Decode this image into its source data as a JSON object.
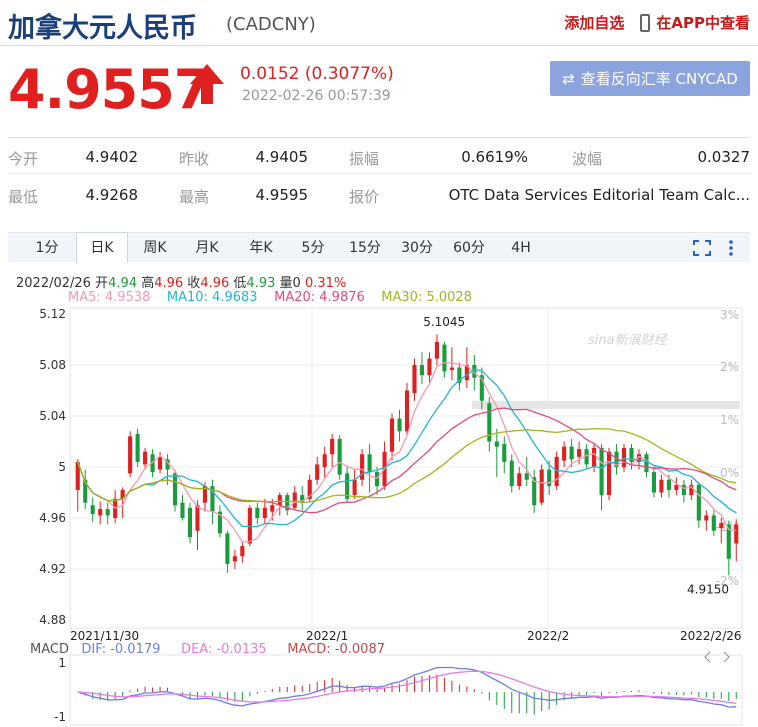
{
  "header": {
    "title": "加拿大元人民币",
    "symbol": "(CADCNY)",
    "add_watchlist": "添加自选",
    "view_in_app": "在APP中查看"
  },
  "quote": {
    "price": "4.9557",
    "change": "0.0152 (0.3077%)",
    "timestamp": "2022-02-26 00:57:39",
    "reverse_button": "查看反向汇率 CNYCAD"
  },
  "stats": {
    "row1": [
      {
        "label": "今开",
        "value": "4.9402"
      },
      {
        "label": "昨收",
        "value": "4.9405"
      },
      {
        "label": "振幅",
        "value": "0.6619%"
      },
      {
        "label": "波幅",
        "value": "0.0327"
      }
    ],
    "row2": [
      {
        "label": "最低",
        "value": "4.9268"
      },
      {
        "label": "最高",
        "value": "4.9595"
      },
      {
        "label": "报价",
        "value": "OTC Data Services Editorial Team Calc..."
      }
    ]
  },
  "tabs": [
    "1分",
    "日K",
    "周K",
    "月K",
    "年K",
    "5分",
    "15分",
    "30分",
    "60分",
    "4H"
  ],
  "active_tab": "日K",
  "ohlc": {
    "date": "2022/02/26",
    "open_label": "开",
    "open": "4.94",
    "high_label": "高",
    "high": "4.96",
    "close_label": "收",
    "close": "4.96",
    "low_label": "低",
    "low": "4.93",
    "vol_label": "量",
    "vol": "0",
    "pct": "0.31%"
  },
  "ma": {
    "ma5": "MA5: 4.9538",
    "ma10": "MA10: 4.9683",
    "ma20": "MA20: 4.9876",
    "ma30": "MA30: 5.0028"
  },
  "macd": {
    "title": "MACD",
    "dif": "DIF: -0.0179",
    "dea": "DEA: -0.0135",
    "macd": "MACD: -0.0087"
  },
  "watermark": "sina新浪财经",
  "colors": {
    "up": "#e01f1f",
    "down": "#1a9c3c",
    "ma5": "#f29bb3",
    "ma10": "#22b5d6",
    "ma20": "#e24b7d",
    "ma30": "#9fb71e",
    "dif": "#6b7fe3",
    "dea": "#e57be6",
    "title": "#1a3f7a"
  },
  "chart_data": {
    "type": "candlestick",
    "y_ticks": [
      "5.12",
      "5.08",
      "5.04",
      "5",
      "4.96",
      "4.92",
      "4.88"
    ],
    "y_right_ticks": [
      "3%",
      "2%",
      "1%",
      "0%",
      "-1%",
      "-2%"
    ],
    "x_labels": [
      "2021/11/30",
      "2022/1",
      "2022/2",
      "2022/2/26"
    ],
    "ylim": [
      4.88,
      5.12
    ],
    "annotations": {
      "high": "5.1045",
      "low": "4.9150"
    },
    "candles": [
      [
        4.982,
        5.004,
        4.965,
        5.006
      ],
      [
        4.99,
        4.972,
        4.967,
        4.998
      ],
      [
        4.97,
        4.963,
        4.957,
        4.976
      ],
      [
        4.962,
        4.967,
        4.955,
        4.973
      ],
      [
        4.967,
        4.962,
        4.955,
        4.972
      ],
      [
        4.96,
        4.975,
        4.956,
        4.982
      ],
      [
        4.975,
        4.982,
        4.96,
        4.984
      ],
      [
        4.995,
        5.024,
        4.992,
        5.028
      ],
      [
        5.026,
        5.004,
        5.0,
        5.03
      ],
      [
        5.002,
        5.012,
        4.998,
        5.015
      ],
      [
        5.01,
        4.996,
        4.992,
        5.014
      ],
      [
        4.998,
        5.008,
        4.995,
        5.012
      ],
      [
        5.006,
        4.998,
        4.986,
        5.01
      ],
      [
        4.995,
        4.97,
        4.965,
        4.998
      ],
      [
        4.972,
        4.96,
        4.958,
        4.978
      ],
      [
        4.968,
        4.945,
        4.94,
        4.972
      ],
      [
        4.95,
        4.97,
        4.935,
        4.974
      ],
      [
        4.972,
        4.985,
        4.965,
        4.988
      ],
      [
        4.985,
        4.965,
        4.955,
        4.99
      ],
      [
        4.965,
        4.948,
        4.945,
        4.97
      ],
      [
        4.948,
        4.924,
        4.917,
        4.95
      ],
      [
        4.926,
        4.93,
        4.92,
        4.935
      ],
      [
        4.93,
        4.938,
        4.925,
        4.942
      ],
      [
        4.94,
        4.968,
        4.938,
        4.97
      ],
      [
        4.968,
        4.96,
        4.955,
        4.972
      ],
      [
        4.96,
        4.968,
        4.956,
        4.975
      ],
      [
        4.965,
        4.97,
        4.958,
        4.975
      ],
      [
        4.97,
        4.978,
        4.962,
        4.98
      ],
      [
        4.978,
        4.966,
        4.962,
        4.98
      ],
      [
        4.968,
        4.98,
        4.966,
        4.985
      ],
      [
        4.978,
        4.972,
        4.966,
        4.985
      ],
      [
        4.975,
        4.99,
        4.973,
        4.994
      ],
      [
        4.99,
        5.002,
        4.986,
        5.008
      ],
      [
        5.0,
        5.01,
        4.992,
        5.016
      ],
      [
        5.01,
        5.022,
        5.0,
        5.026
      ],
      [
        5.022,
        4.994,
        4.99,
        5.025
      ],
      [
        4.995,
        4.975,
        4.972,
        5.0
      ],
      [
        4.978,
        4.99,
        4.975,
        4.998
      ],
      [
        4.99,
        5.01,
        4.985,
        5.014
      ],
      [
        5.01,
        4.996,
        4.98,
        5.018
      ],
      [
        4.996,
        4.985,
        4.978,
        5.0
      ],
      [
        4.985,
        5.012,
        4.982,
        5.02
      ],
      [
        5.012,
        5.038,
        5.005,
        5.042
      ],
      [
        5.038,
        5.028,
        5.02,
        5.045
      ],
      [
        5.028,
        5.06,
        5.025,
        5.066
      ],
      [
        5.058,
        5.08,
        5.052,
        5.085
      ],
      [
        5.08,
        5.072,
        5.065,
        5.09
      ],
      [
        5.072,
        5.085,
        5.066,
        5.09
      ],
      [
        5.085,
        5.098,
        5.08,
        5.104
      ],
      [
        5.096,
        5.075,
        5.07,
        5.098
      ],
      [
        5.076,
        5.078,
        5.068,
        5.094
      ],
      [
        5.078,
        5.066,
        5.06,
        5.082
      ],
      [
        5.068,
        5.08,
        5.062,
        5.094
      ],
      [
        5.08,
        5.07,
        5.06,
        5.088
      ],
      [
        5.072,
        5.052,
        5.045,
        5.078
      ],
      [
        5.05,
        5.02,
        5.012,
        5.055
      ],
      [
        5.02,
        5.016,
        4.992,
        5.03
      ],
      [
        5.018,
        5.004,
        4.995,
        5.024
      ],
      [
        5.005,
        4.985,
        4.98,
        5.01
      ],
      [
        4.985,
        4.995,
        4.982,
        5.0
      ],
      [
        4.995,
        4.99,
        4.985,
        5.008
      ],
      [
        4.992,
        4.97,
        4.964,
        4.998
      ],
      [
        4.972,
        4.998,
        4.97,
        5.002
      ],
      [
        4.998,
        4.985,
        4.978,
        5.005
      ],
      [
        4.985,
        5.008,
        4.982,
        5.012
      ],
      [
        5.005,
        5.016,
        5.0,
        5.02
      ],
      [
        5.016,
        5.006,
        5.0,
        5.022
      ],
      [
        5.008,
        5.014,
        5.002,
        5.02
      ],
      [
        5.014,
        5.002,
        4.998,
        5.018
      ],
      [
        5.0,
        5.015,
        4.996,
        5.018
      ],
      [
        5.015,
        4.978,
        4.966,
        5.018
      ],
      [
        4.978,
        5.012,
        4.974,
        5.015
      ],
      [
        5.012,
        5.0,
        4.994,
        5.018
      ],
      [
        5.0,
        5.015,
        4.996,
        5.018
      ],
      [
        5.015,
        5.004,
        4.998,
        5.018
      ],
      [
        5.004,
        5.01,
        4.998,
        5.014
      ],
      [
        5.01,
        4.996,
        4.992,
        5.012
      ],
      [
        4.996,
        4.98,
        4.976,
        5.0
      ],
      [
        4.98,
        4.99,
        4.976,
        4.994
      ],
      [
        4.99,
        4.982,
        4.976,
        4.994
      ],
      [
        4.982,
        4.986,
        4.978,
        4.992
      ],
      [
        4.986,
        4.978,
        4.972,
        4.99
      ],
      [
        4.978,
        4.986,
        4.974,
        4.99
      ],
      [
        4.986,
        4.958,
        4.952,
        4.988
      ],
      [
        4.958,
        4.962,
        4.95,
        4.966
      ],
      [
        4.962,
        4.95,
        4.946,
        4.966
      ],
      [
        4.952,
        4.956,
        4.94,
        4.96
      ],
      [
        4.955,
        4.928,
        4.915,
        4.958
      ],
      [
        4.94,
        4.955,
        4.926,
        4.959
      ]
    ]
  }
}
